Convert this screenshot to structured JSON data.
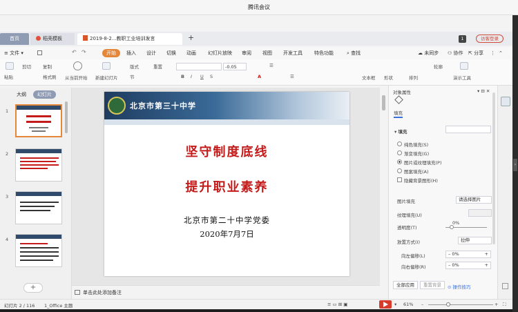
{
  "window": {
    "title": "腾讯会议"
  },
  "tabs": [
    {
      "label": "首页"
    },
    {
      "label": "稻壳模板"
    },
    {
      "label": "2019-8-2...教职工业培训发言"
    }
  ],
  "user": {
    "badge": "1",
    "login_label": "访客登录"
  },
  "menu": {
    "file": "文件",
    "items": [
      "开始",
      "插入",
      "设计",
      "切换",
      "动画",
      "幻灯片放映",
      "审阅",
      "视图",
      "开发工具",
      "特色功能"
    ],
    "search": "查找",
    "sync": "未同步",
    "collab": "协作",
    "share": "分享"
  },
  "ribbon": {
    "paste": "粘贴",
    "cut": "剪切",
    "copy": "复制",
    "format_painter": "格式刷",
    "play_from_current": "从当前开始",
    "new_slide": "新建幻灯片",
    "layout": "版式",
    "section": "节",
    "reset": "重置",
    "font_size": "-0.05",
    "text_box": "文本框",
    "shape": "形状",
    "arrange": "排列",
    "outline": "轮廓",
    "presenter": "演示工具"
  },
  "left_panel": {
    "tab_outline": "大纲",
    "tab_slides": "幻灯片",
    "slide_numbers": [
      "1",
      "2",
      "3",
      "4"
    ]
  },
  "slide": {
    "school_name": "北京市第三十中学",
    "title_line1": "坚守制度底线",
    "title_line2": "提升职业素养",
    "org": "北京市第二十中学党委",
    "date": "2020年7月7日"
  },
  "notes": {
    "placeholder": "单击此处添加备注"
  },
  "properties": {
    "header": "对象属性",
    "tab_fill": "填充",
    "section_fill": "填充",
    "options": [
      {
        "label": "纯色填充(S)",
        "checked": false
      },
      {
        "label": "渐变填充(G)",
        "checked": false
      },
      {
        "label": "图片或纹理填充(P)",
        "checked": true
      },
      {
        "label": "图案填充(A)",
        "checked": false
      }
    ],
    "hide_bg": "隐藏背景图形(H)",
    "picture_fill_label": "图片填充",
    "picture_fill_value": "请选择图片",
    "texture_fill_label": "纹理填充(U)",
    "transparency_label": "透明度(T)",
    "transparency_value": "0%",
    "placement_label": "放置方式(I)",
    "placement_value": "拉伸",
    "offset_left_label": "向左偏移(L)",
    "offset_left_value": "0%",
    "offset_right_label": "向右偏移(R)",
    "offset_right_value": "0%",
    "apply_all": "全部应用",
    "reset_bg": "重置背景",
    "tips": "操作技巧"
  },
  "status": {
    "slide_info": "幻灯片 2 / 116",
    "theme": "1_Office 主题",
    "zoom": "61%"
  }
}
